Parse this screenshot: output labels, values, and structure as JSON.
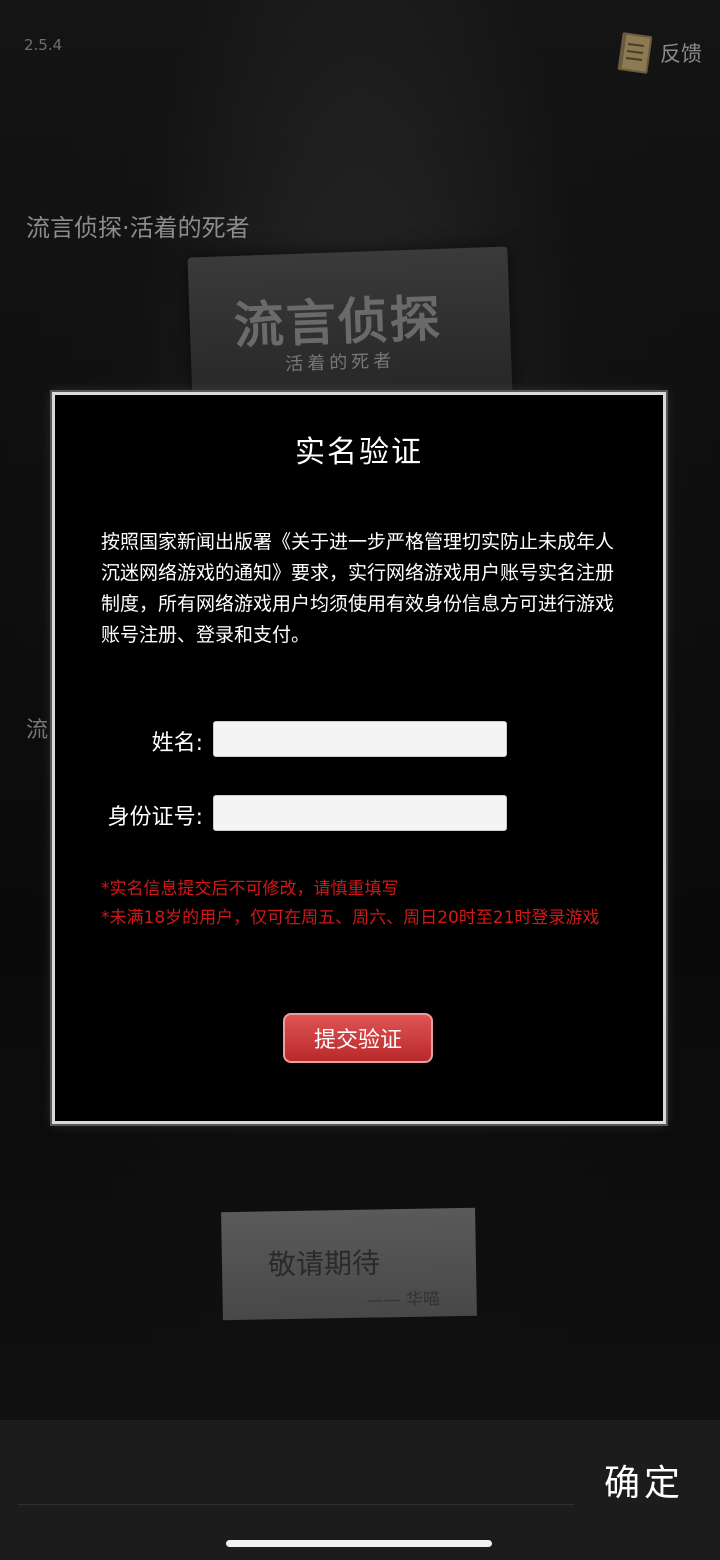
{
  "app": {
    "version": "2.5.4",
    "feedback_label": "反馈"
  },
  "background": {
    "game_title": "流言侦探·活着的死者",
    "book_title": "流言侦探",
    "book_subtitle": "活着的死者",
    "second_title_fragment": "流",
    "note_text": "敬请期待",
    "note_signature": "—— 华喵"
  },
  "modal": {
    "title": "实名验证",
    "notice": "按照国家新闻出版署《关于进一步严格管理切实防止未成年人沉迷网络游戏的通知》要求，实行网络游戏用户账号实名注册制度，所有网络游戏用户均须使用有效身份信息方可进行游戏账号注册、登录和支付。",
    "name_label": "姓名:",
    "name_value": "",
    "id_label": "身份证号:",
    "id_value": "",
    "warning_1": "*实名信息提交后不可修改，请慎重填写",
    "warning_2": "*未满18岁的用户，仅可在周五、周六、周日20时至21时登录游戏",
    "submit_label": "提交验证"
  },
  "bottom_bar": {
    "confirm_label": "确定"
  },
  "colors": {
    "warning": "#d21818",
    "submit": "#c8383a"
  }
}
